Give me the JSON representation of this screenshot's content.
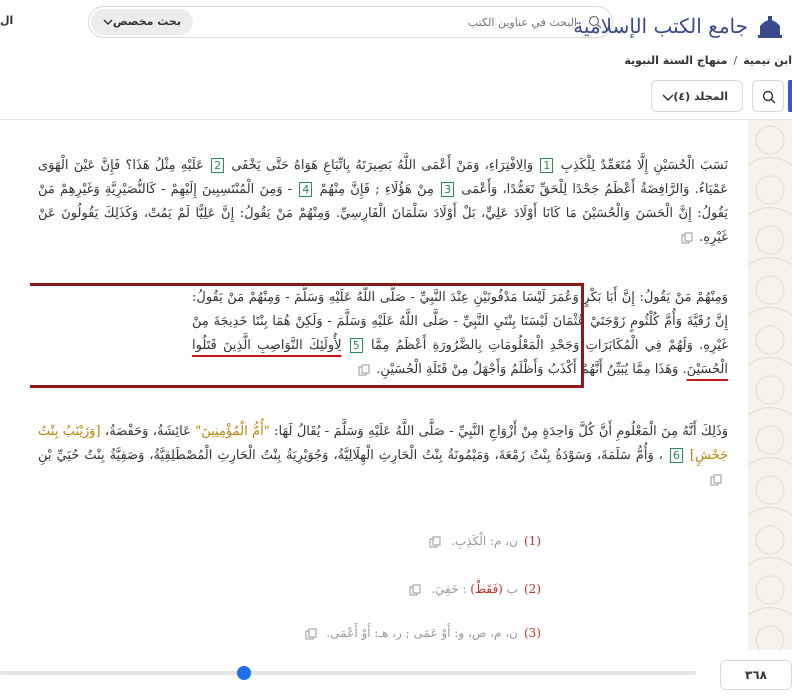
{
  "header": {
    "logo_text": "جامع الكتب الإسلامية",
    "search_placeholder": "البحث في عناوين الكتب",
    "advanced_search_label": "بحث مخصص",
    "edge_text": "ال"
  },
  "breadcrumb": {
    "items": [
      "منهاج السنة النبوية",
      "ابن تيمية"
    ],
    "separator": "/"
  },
  "toolbar": {
    "volume_label": "المجلد (٤)"
  },
  "content": {
    "paragraphs": [
      {
        "segments": [
          {
            "text": "نَسَبَ الْحُسَيْنِ إِلَّا مُتَعَمِّدٌ لِلْكَذِبِ "
          },
          {
            "fn": "1"
          },
          {
            "text": " وَالِافْتِرَاءِ، وَمَنْ أَعْمَى اللَّهُ بَصِيرَتَهُ بِاتِّبَاعِ هَوَاهُ حَتَّى يَخْفَى "
          },
          {
            "fn": "2"
          },
          {
            "text": " عَلَيْهِ مِثْلُ هَذَا؟ فَإِنَّ عَيْنَ الْهَوَى عَمْيَاءُ. وَالرَّافِضَةُ أَعْظَمُ جَحْدًا لِلْحَقِّ تَعَمُّدًا، وَأَعْمَى "
          },
          {
            "fn": "3"
          },
          {
            "text": " مِنْ هَؤُلَاءِ ; فَإِنَّ مِنْهُمْ "
          },
          {
            "fn": "4"
          },
          {
            "text": " - وَمِنَ الْمُنْتَسِبِينَ إِلَيْهِمْ - كَالنُّصَيْرِيَّةِ وَغَيْرِهِمْ مَنْ يَقُولُ: إِنَّ الْحَسَنَ وَالْحُسَيْنَ مَا كَانَا أَوْلَادَ عَلِيٍّ، بَلْ أَوْلَادَ سَلْمَانَ الْفَارِسِيِّ. وَمِنْهُمْ مَنْ يَقُولُ: إِنَّ عَلِيًّا لَمْ يَمُتْ، وَكَذَلِكَ يَقُولُونَ عَنْ غَيْرِهِ."
          }
        ]
      },
      {
        "segments": [
          {
            "text": "وَمِنْهُمْ مَنْ يَقُولُ: إِنَّ أَبَا بَكْرٍ وَعُمَرَ لَيْسَا مَدْفُونَيْنِ عِنْدَ النَّبِيِّ - صَلَّى اللَّهُ عَلَيْهِ وَسَلَّمَ - وَمِنْهُمْ مَنْ يَقُولُ: إِنَّ رُقَيَّةَ وَأُمَّ كُلْثُومٍ زَوْجَتَيْ عُثْمَانَ لَيْسَتَا بِنْتَيِ النَّبِيِّ - صَلَّى اللَّهُ عَلَيْهِ وَسَلَّمَ - وَلَكِنْ هُمَا بِنْتَا خَدِيجَةَ مِنْ غَيْرِهِ. وَلَهُمْ فِي الْمُكَابَرَاتِ وَجَحْدِ الْمَعْلُومَاتِ بِالضَّرُورَةِ أَعْظَمُ مِمَّا "
          },
          {
            "fn": "5"
          },
          {
            "text": " "
          },
          {
            "hl": "لِأُولَئِكَ النَّوَاصِبِ الَّذِينَ قَتَلُوا الْحُسَيْنَ"
          },
          {
            "text": ". وَهَذَا مِمَّا يُبَيِّنُ أَنَّهُمْ أَكْذَبُ وَأَظْلَمُ وَأَجْهَلُ مِنْ قَتَلَةِ الْحُسَيْنِ."
          }
        ]
      },
      {
        "segments": [
          {
            "text": "وَذَلِكَ أَنَّهُ مِنَ الْمَعْلُومِ أَنَّ كُلَّ وَاحِدَةٍ مِنْ أَزْوَاجِ النَّبِيِّ - صَلَّى اللَّهُ عَلَيْهِ وَسَلَّمَ - يُقَالُ لَهَا: "
          },
          {
            "hon": "\"أُمُّ الْمُؤْمِنِينَ\""
          },
          {
            "text": " عَائِشَةُ، وَحَفْصَةُ، "
          },
          {
            "hon": "[وَزَيْنَبُ بِنْتُ جَحْشٍ]"
          },
          {
            "text": " "
          },
          {
            "fn": "6"
          },
          {
            "text": " ، وَأُمُّ سَلَمَةَ، وَسَوْدَةُ بِنْتُ زَمْعَةَ، وَمَيْمُونَةُ بِنْتُ الْحَارِثِ الْهِلَالِيَّةُ، وَجُوَيْرِيَةُ بِنْتُ الْحَارِثِ الْمُصْطَلِقِيَّةُ، وَصَفِيَّةُ بِنْتُ حُيَيِّ بْنِ"
          }
        ]
      }
    ],
    "footnotes": [
      {
        "num": "(1)",
        "text": "ن، م: الْكَذِبِ."
      },
      {
        "num": "(2)",
        "marker": "(فَقَطْ)",
        "prefix": "ب ",
        "text": " : خَفِيَ."
      },
      {
        "num": "(3)",
        "text": "ن، م، ص، و: أَوْ عَمَى ; ر، هـ: أَوْ أَعْمَى."
      }
    ]
  },
  "bottom": {
    "page_number": "٣٦٨",
    "slider_position_fraction": 0.35
  },
  "colors": {
    "accent_blue": "#2b5bd7",
    "highlight_border": "#8b1a1a",
    "underline_red": "#c8161d",
    "footnote_green": "#2e8b57",
    "note_red": "#c0392b"
  }
}
